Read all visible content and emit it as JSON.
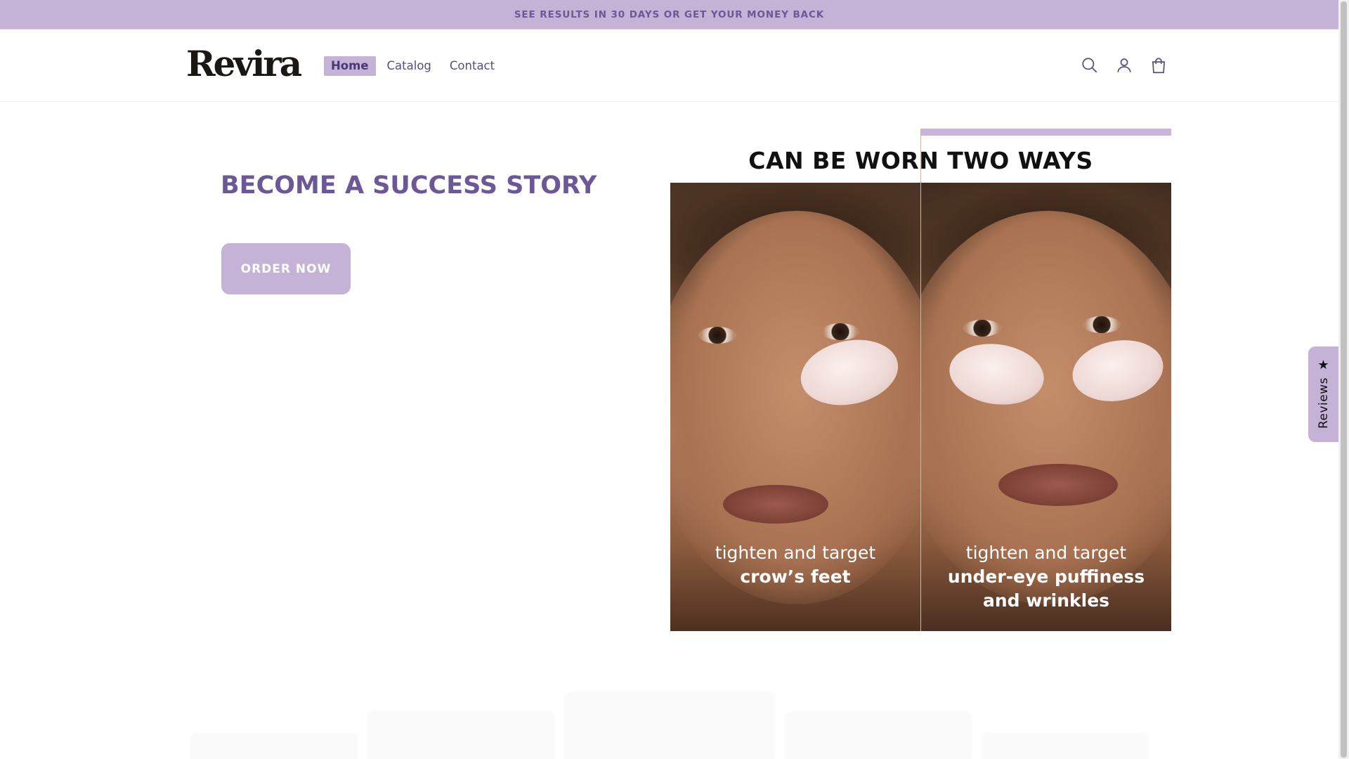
{
  "announcement": {
    "text": "SEE RESULTS IN 30 DAYS OR GET YOUR MONEY BACK"
  },
  "header": {
    "logo": "Revira",
    "nav": [
      {
        "label": "Home",
        "active": true
      },
      {
        "label": "Catalog",
        "active": false
      },
      {
        "label": "Contact",
        "active": false
      }
    ],
    "icons": [
      "search-icon",
      "account-icon",
      "cart-icon"
    ]
  },
  "hero": {
    "title": "BECOME A SUCCESS STORY",
    "cta": "ORDER NOW",
    "image": {
      "headline": "CAN BE WORN TWO WAYS",
      "left_caption": {
        "line1": "tighten and target",
        "line2": "crow’s feet"
      },
      "right_caption": {
        "line1": "tighten and target",
        "line2": "under-eye puffiness",
        "line3": "and wrinkles"
      }
    }
  },
  "reviews_tab": {
    "label": "Reviews",
    "icon": "star-icon"
  },
  "colors": {
    "accent": "#c4b2d7",
    "accent_text": "#6c5897"
  }
}
